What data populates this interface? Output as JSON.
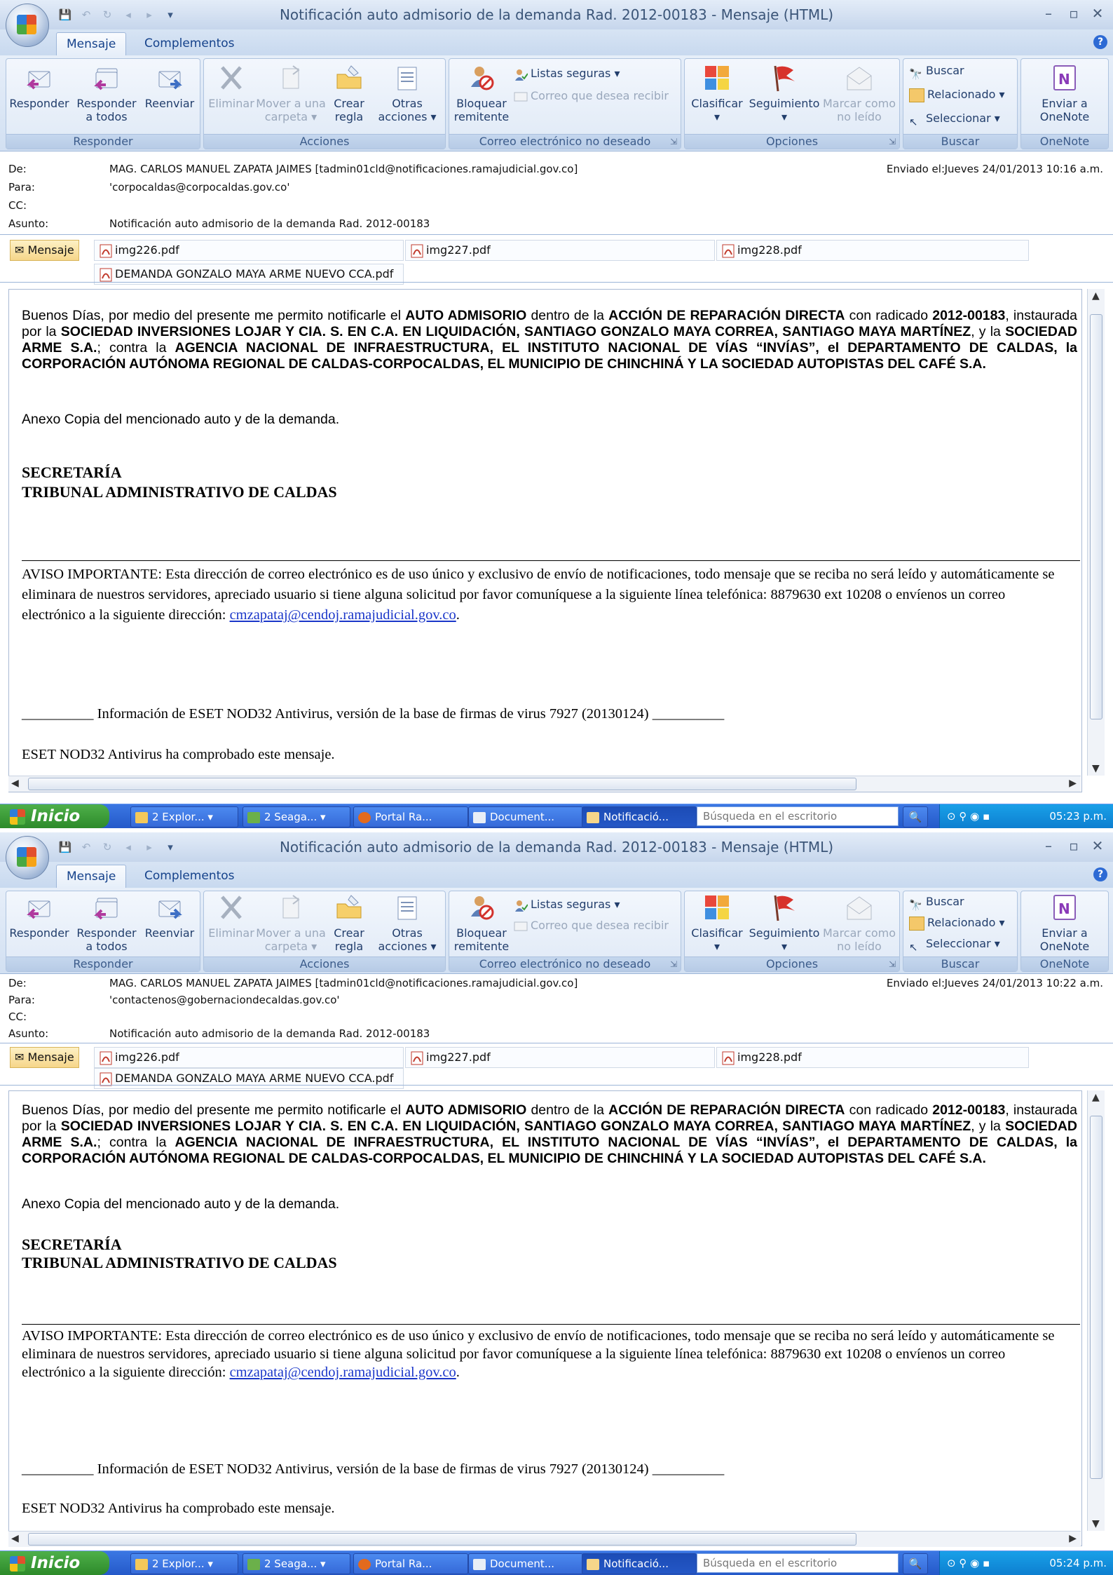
{
  "window": {
    "title": "Notificación auto admisorio de la demanda Rad. 2012-00183 - Mensaje (HTML)",
    "tabs": [
      "Mensaje",
      "Complementos"
    ]
  },
  "ribbon": {
    "responder": {
      "group": "Responder",
      "reply": "Responder",
      "reply_all_1": "Responder",
      "reply_all_2": "a todos",
      "forward": "Reenviar"
    },
    "acciones": {
      "group": "Acciones",
      "delete": "Eliminar",
      "move_1": "Mover a una",
      "move_2": "carpeta",
      "rule_1": "Crear",
      "rule_2": "regla",
      "other_1": "Otras",
      "other_2": "acciones"
    },
    "junk": {
      "group": "Correo electrónico no deseado",
      "block_1": "Bloquear",
      "block_2": "remitente",
      "safe_lists": "Listas seguras",
      "not_junk": "Correo que desea recibir"
    },
    "opciones": {
      "group": "Opciones",
      "categorize": "Clasificar",
      "followup": "Seguimiento",
      "mark_1": "Marcar como",
      "mark_2": "no leído"
    },
    "buscar": {
      "group": "Buscar",
      "find": "Buscar",
      "related": "Relacionado",
      "select": "Seleccionar"
    },
    "onenote": {
      "group": "OneNote",
      "send_1": "Enviar a",
      "send_2": "OneNote"
    }
  },
  "labels": {
    "from": "De:",
    "to": "Para:",
    "cc": "CC:",
    "subject": "Asunto:",
    "sent": "Enviado el:",
    "message_tab": "Mensaje"
  },
  "messages": [
    {
      "from": "MAG. CARLOS MANUEL ZAPATA JAIMES [tadmin01cld@notificaciones.ramajudicial.gov.co]",
      "to": "'corpocaldas@corpocaldas.gov.co'",
      "sent": "Jueves 24/01/2013 10:16 a.m.",
      "subject": "Notificación auto admisorio de la demanda Rad. 2012-00183",
      "clock": "05:23 p.m."
    },
    {
      "from": "MAG. CARLOS MANUEL ZAPATA JAIMES [tadmin01cld@notificaciones.ramajudicial.gov.co]",
      "to": "'contactenos@gobernaciondecaldas.gov.co'",
      "sent": "Jueves 24/01/2013 10:22 a.m.",
      "subject": "Notificación auto admisorio de la demanda Rad. 2012-00183",
      "clock": "05:24 p.m."
    }
  ],
  "attachments": [
    "img226.pdf",
    "img227.pdf",
    "img228.pdf",
    "DEMANDA GONZALO MAYA ARME NUEVO CCA.pdf"
  ],
  "body": {
    "p1_a": "Buenos Días, por medio del presente me permito notificarle el ",
    "p1_b": "AUTO ADMISORIO",
    "p1_c": " dentro de la ",
    "p1_d": "ACCIÓN DE REPARACIÓN DIRECTA",
    "p1_e": " con radicado ",
    "p1_f": "2012-00183",
    "p1_g": ", instaurada por la ",
    "p1_h": "SOCIEDAD INVERSIONES LOJAR Y CIA. S. EN C.A. EN LIQUIDACIÓN, SANTIAGO GONZALO MAYA CORREA, SANTIAGO MAYA MARTÍNEZ",
    "p1_i": ", y la ",
    "p1_j": "SOCIEDAD ARME S.A.",
    "p1_k": "; contra la ",
    "p1_l": "AGENCIA NACIONAL DE INFRAESTRUCTURA, EL INSTITUTO NACIONAL DE VÍAS “INVÍAS”, el DEPARTAMENTO DE CALDAS, la CORPORACIÓN AUTÓNOMA REGIONAL DE CALDAS-CORPOCALDAS, EL MUNICIPIO DE CHINCHINÁ Y LA SOCIEDAD AUTOPISTAS DEL CAFÉ S.A.",
    "annex": "Anexo Copia del mencionado auto y de la demanda.",
    "sig1": "SECRETARÍA",
    "sig2": "TRIBUNAL ADMINISTRATIVO DE CALDAS",
    "notice": "AVISO IMPORTANTE: Esta dirección de correo electrónico es de uso único y exclusivo de envío de notificaciones, todo mensaje que se reciba no será leído y automáticamente se eliminara de nuestros servidores, apreciado usuario si tiene alguna solicitud por favor comuníquese a la siguiente línea telefónica: 8879630 ext 10208 o envíenos un correo electrónico a la siguiente dirección: ",
    "email": "cmzapataj@cendoj.ramajudicial.gov.co",
    "eset_line": "__________ Información de ESET NOD32 Antivirus, versión de la base de firmas de virus 7927 (20130124) __________",
    "eset_ok": "ESET NOD32 Antivirus ha comprobado este mensaje."
  },
  "taskbar": {
    "start": "Inicio",
    "items": [
      "2 Explor...",
      "2 Seaga...",
      "Portal Ra...",
      "Document...",
      "Notificació..."
    ],
    "search_placeholder": "Búsqueda en el escritorio"
  },
  "colors": {
    "link": "#1a36c9",
    "ribbon": "#d2e0f2",
    "taskbar": "#2459c9"
  }
}
